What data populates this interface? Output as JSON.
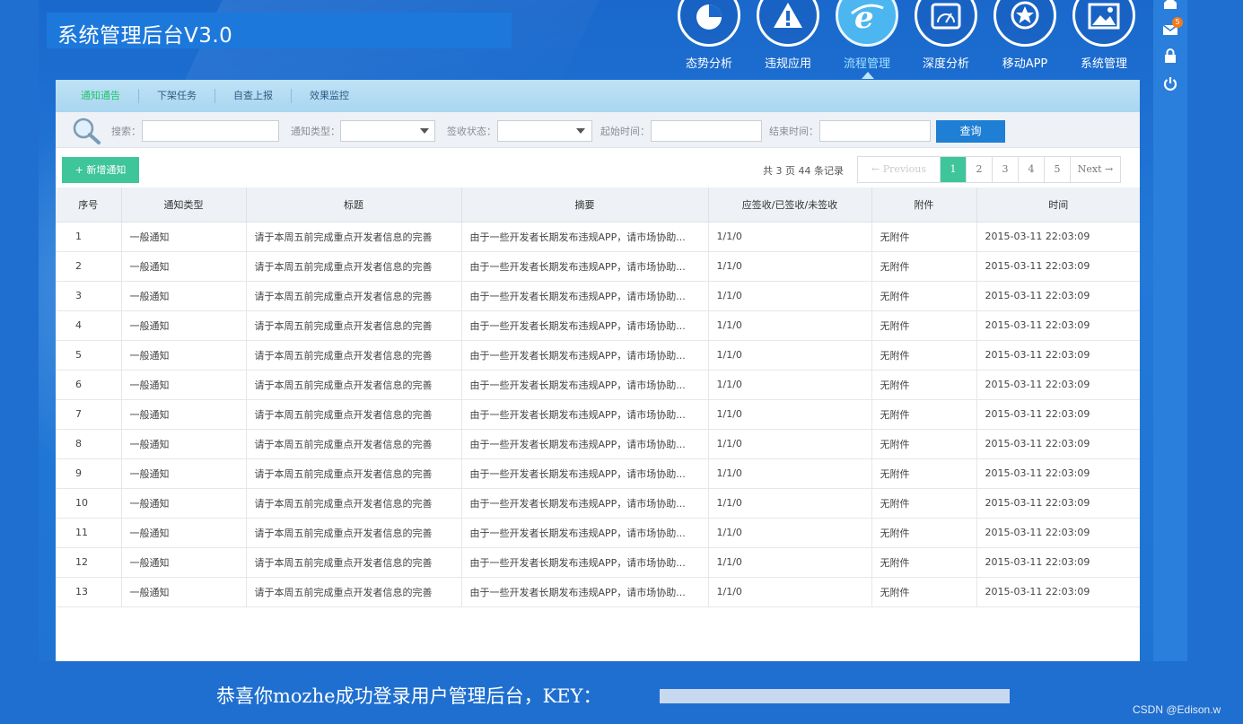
{
  "app": {
    "title": "系统管理后台V3.0"
  },
  "nav": [
    {
      "label": "态势分析",
      "icon": "pie-chart-icon"
    },
    {
      "label": "违规应用",
      "icon": "warning-icon"
    },
    {
      "label": "流程管理",
      "icon": "ie-browser-icon",
      "active": true
    },
    {
      "label": "深度分析",
      "icon": "gauge-icon"
    },
    {
      "label": "移动APP",
      "icon": "star-icon"
    },
    {
      "label": "系统管理",
      "icon": "landscape-image-icon"
    }
  ],
  "rightbar": {
    "mail_badge": "5",
    "icons": [
      "home-icon",
      "mail-icon",
      "lock-icon",
      "power-icon"
    ]
  },
  "tabs": [
    {
      "label": "通知通告",
      "active": true
    },
    {
      "label": "下架任务"
    },
    {
      "label": "自查上报"
    },
    {
      "label": "效果监控"
    }
  ],
  "search": {
    "search_label": "搜索：",
    "type_label": "通知类型：",
    "status_label": "签收状态：",
    "start_label": "起始时间：",
    "end_label": "结束时间：",
    "query_button": "查询"
  },
  "toolbar": {
    "add_button": "+ 新增通知",
    "pager_info": "共 3 页 44 条记录",
    "prev": "← Previous",
    "pages": [
      "1",
      "2",
      "3",
      "4",
      "5"
    ],
    "current_page": "1",
    "next": "Next →"
  },
  "table": {
    "headers": [
      "序号",
      "通知类型",
      "标题",
      "摘要",
      "应签收/已签收/未签收",
      "附件",
      "时间"
    ],
    "rows": [
      [
        "1",
        "一般通知",
        "请于本周五前完成重点开发者信息的完善",
        "由于一些开发者长期发布违规APP，请市场协助...",
        "1/1/0",
        "无附件",
        "2015-03-11 22:03:09"
      ],
      [
        "2",
        "一般通知",
        "请于本周五前完成重点开发者信息的完善",
        "由于一些开发者长期发布违规APP，请市场协助...",
        "1/1/0",
        "无附件",
        "2015-03-11 22:03:09"
      ],
      [
        "3",
        "一般通知",
        "请于本周五前完成重点开发者信息的完善",
        "由于一些开发者长期发布违规APP，请市场协助...",
        "1/1/0",
        "无附件",
        "2015-03-11 22:03:09"
      ],
      [
        "4",
        "一般通知",
        "请于本周五前完成重点开发者信息的完善",
        "由于一些开发者长期发布违规APP，请市场协助...",
        "1/1/0",
        "无附件",
        "2015-03-11 22:03:09"
      ],
      [
        "5",
        "一般通知",
        "请于本周五前完成重点开发者信息的完善",
        "由于一些开发者长期发布违规APP，请市场协助...",
        "1/1/0",
        "无附件",
        "2015-03-11 22:03:09"
      ],
      [
        "6",
        "一般通知",
        "请于本周五前完成重点开发者信息的完善",
        "由于一些开发者长期发布违规APP，请市场协助...",
        "1/1/0",
        "无附件",
        "2015-03-11 22:03:09"
      ],
      [
        "7",
        "一般通知",
        "请于本周五前完成重点开发者信息的完善",
        "由于一些开发者长期发布违规APP，请市场协助...",
        "1/1/0",
        "无附件",
        "2015-03-11 22:03:09"
      ],
      [
        "8",
        "一般通知",
        "请于本周五前完成重点开发者信息的完善",
        "由于一些开发者长期发布违规APP，请市场协助...",
        "1/1/0",
        "无附件",
        "2015-03-11 22:03:09"
      ],
      [
        "9",
        "一般通知",
        "请于本周五前完成重点开发者信息的完善",
        "由于一些开发者长期发布违规APP，请市场协助...",
        "1/1/0",
        "无附件",
        "2015-03-11 22:03:09"
      ],
      [
        "10",
        "一般通知",
        "请于本周五前完成重点开发者信息的完善",
        "由于一些开发者长期发布违规APP，请市场协助...",
        "1/1/0",
        "无附件",
        "2015-03-11 22:03:09"
      ],
      [
        "11",
        "一般通知",
        "请于本周五前完成重点开发者信息的完善",
        "由于一些开发者长期发布违规APP，请市场协助...",
        "1/1/0",
        "无附件",
        "2015-03-11 22:03:09"
      ],
      [
        "12",
        "一般通知",
        "请于本周五前完成重点开发者信息的完善",
        "由于一些开发者长期发布违规APP，请市场协助...",
        "1/1/0",
        "无附件",
        "2015-03-11 22:03:09"
      ],
      [
        "13",
        "一般通知",
        "请于本周五前完成重点开发者信息的完善",
        "由于一些开发者长期发布违规APP，请市场协助...",
        "1/1/0",
        "无附件",
        "2015-03-11 22:03:09"
      ]
    ]
  },
  "footer": {
    "message": "恭喜你mozhe成功登录用户管理后台，KEY："
  },
  "watermark": "CSDN @Edison.w",
  "colors": {
    "accent_green": "#3fc59a",
    "query_blue": "#1f7fd4",
    "bg_blue": "#1f6fd0"
  }
}
